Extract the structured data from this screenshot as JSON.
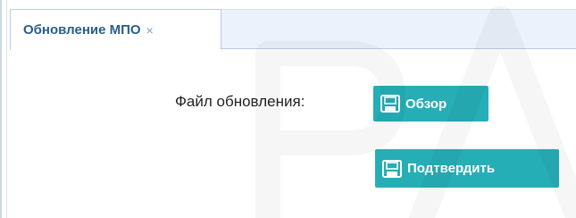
{
  "tab": {
    "label": "Обновление МПО",
    "close_glyph": "×"
  },
  "form": {
    "file_label": "Файл обновления:",
    "browse_label": "Обзор",
    "confirm_label": "Подтвердить"
  },
  "icons": {
    "button_icon": "floppy-disk-icon",
    "tab_close": "close-icon"
  },
  "colors": {
    "button_bg": "#26aeb6",
    "tab_text": "#2a5d8b",
    "tabbar_bg": "#ebf2fb"
  }
}
